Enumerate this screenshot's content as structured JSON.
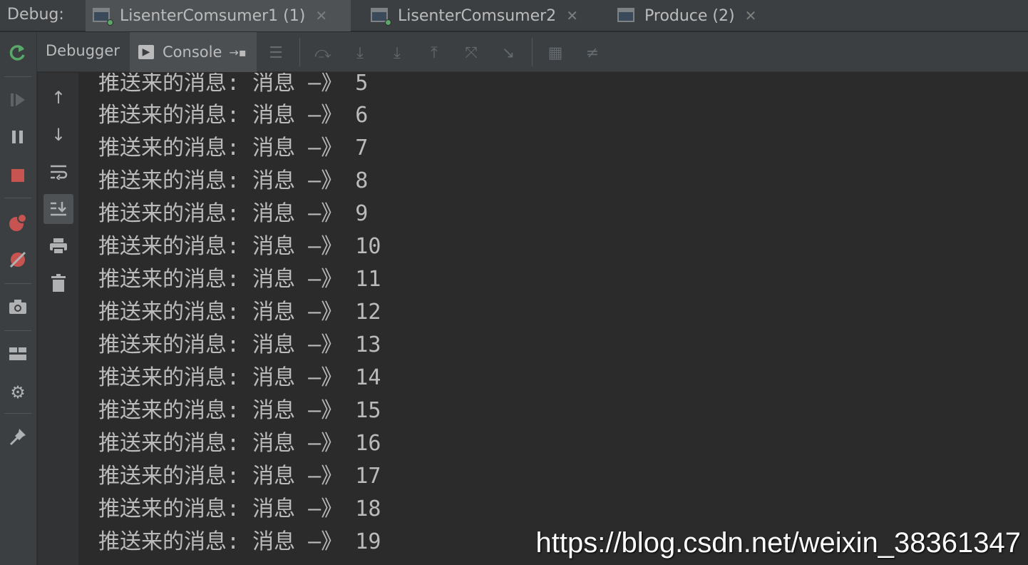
{
  "debug_label": "Debug:",
  "tabs": [
    {
      "label": "LisenterComsumer1 (1)",
      "running": true,
      "active": true
    },
    {
      "label": "LisenterComsumer2",
      "running": true,
      "active": false
    },
    {
      "label": "Produce (2)",
      "running": false,
      "active": false
    }
  ],
  "toolbar": {
    "debugger_label": "Debugger",
    "console_label": "Console"
  },
  "console": {
    "lines": [
      "推送来的消息: 消息 —》 5",
      "推送来的消息: 消息 —》 6",
      "推送来的消息: 消息 —》 7",
      "推送来的消息: 消息 —》 8",
      "推送来的消息: 消息 —》 9",
      "推送来的消息: 消息 —》 10",
      "推送来的消息: 消息 —》 11",
      "推送来的消息: 消息 —》 12",
      "推送来的消息: 消息 —》 13",
      "推送来的消息: 消息 —》 14",
      "推送来的消息: 消息 —》 15",
      "推送来的消息: 消息 —》 16",
      "推送来的消息: 消息 —》 17",
      "推送来的消息: 消息 —》 18",
      "推送来的消息: 消息 —》 19"
    ]
  },
  "watermark": "https://blog.csdn.net/weixin_38361347",
  "colors": {
    "background": "#2b2b2b",
    "panel": "#3c3f41",
    "text": "#bbbbbb",
    "rerun_green": "#59a869",
    "stop_red": "#c75450"
  }
}
